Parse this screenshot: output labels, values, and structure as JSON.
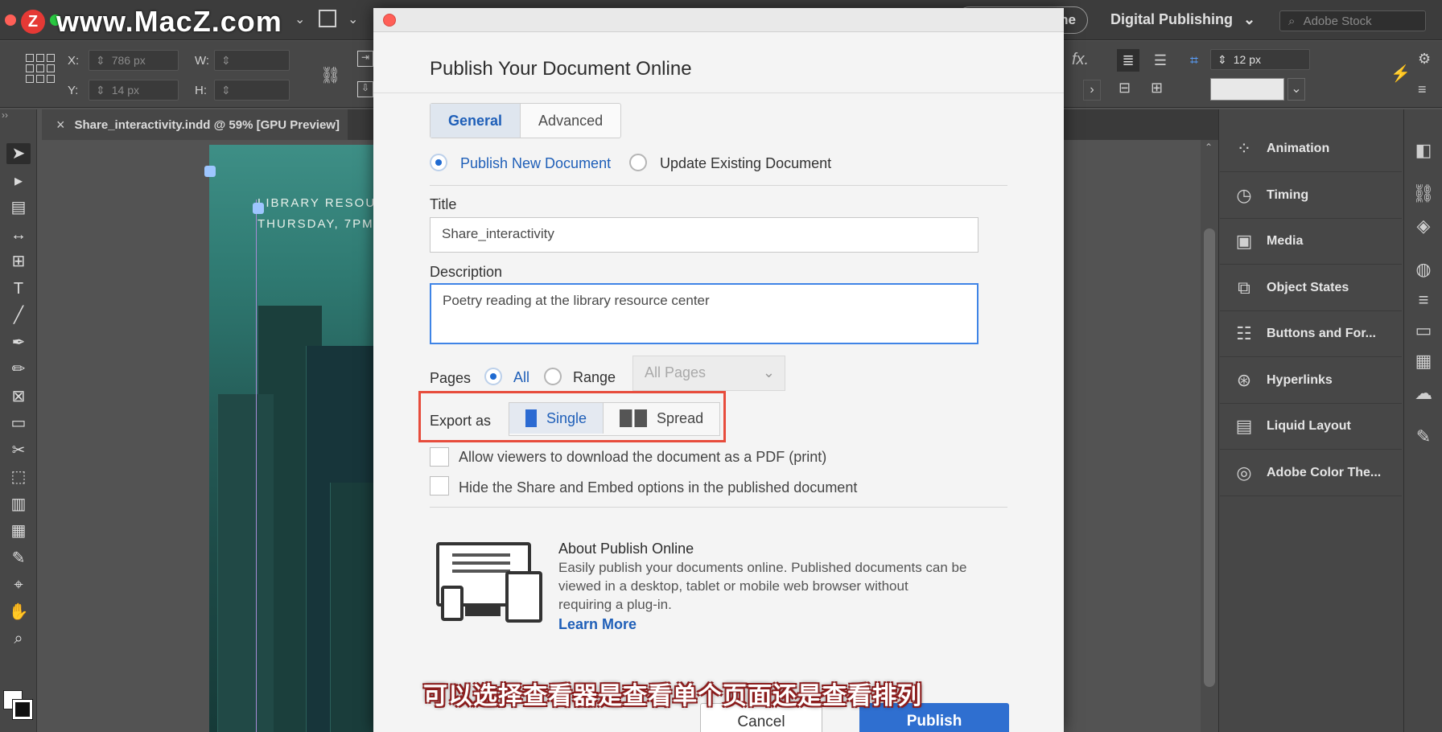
{
  "watermark": {
    "badge": "Z",
    "text": "www.MacZ.com"
  },
  "appbar": {
    "workspace": "Digital Publishing",
    "stock_placeholder": "Adobe Stock",
    "publish_button_fragment": "ne"
  },
  "ctrlbar": {
    "x_label": "X:",
    "x_value": "786 px",
    "y_label": "Y:",
    "y_value": "14 px",
    "w_label": "W:",
    "h_label": "H:",
    "fx": "fx.",
    "stroke_value": "12 px"
  },
  "document_tab": {
    "close": "×",
    "title": "Share_interactivity.indd @ 59% [GPU Preview]"
  },
  "document_page": {
    "line1": "LIBRARY RESOU",
    "line2": "THURSDAY, 7PM"
  },
  "tools": [
    "selection-tool",
    "direct-selection-tool",
    "page-tool",
    "gap-tool",
    "content-collector-tool",
    "type-tool",
    "line-tool",
    "pen-tool",
    "pencil-tool",
    "rectangle-frame-tool",
    "rectangle-tool",
    "scissors-tool",
    "free-transform-tool",
    "gradient-swatch-tool",
    "gradient-feather-tool",
    "note-tool",
    "eyedropper-tool",
    "hand-tool",
    "zoom-tool"
  ],
  "right_panel": {
    "items": [
      {
        "icon": "animation-icon",
        "label": "Animation"
      },
      {
        "icon": "timing-icon",
        "label": "Timing"
      },
      {
        "icon": "media-icon",
        "label": "Media"
      },
      {
        "icon": "object-states-icon",
        "label": "Object States"
      },
      {
        "icon": "buttons-forms-icon",
        "label": "Buttons and For..."
      },
      {
        "icon": "hyperlinks-icon",
        "label": "Hyperlinks"
      },
      {
        "icon": "liquid-layout-icon",
        "label": "Liquid Layout"
      },
      {
        "icon": "adobe-color-themes-icon",
        "label": "Adobe Color The..."
      }
    ]
  },
  "dialog": {
    "title": "Publish Your Document Online",
    "tabs": [
      {
        "label": "General",
        "active": true
      },
      {
        "label": "Advanced",
        "active": false
      }
    ],
    "mode": {
      "new_label": "Publish New Document",
      "update_label": "Update Existing Document",
      "selected": "new"
    },
    "title_field": {
      "label": "Title",
      "value": "Share_interactivity"
    },
    "description_field": {
      "label": "Description",
      "value": "Poetry reading at the library resource center"
    },
    "pages": {
      "label": "Pages",
      "all_label": "All",
      "range_label": "Range",
      "selected": "all",
      "dropdown_value": "All Pages"
    },
    "export_as": {
      "label": "Export as",
      "single_label": "Single",
      "spread_label": "Spread",
      "selected": "single"
    },
    "options": {
      "download_pdf": "Allow viewers to download the document as a PDF (print)",
      "hide_share": "Hide the Share and Embed options in the published document"
    },
    "about": {
      "heading": "About Publish Online",
      "line1": "Easily publish your documents online. Published documents can be",
      "line2": "viewed in a desktop, tablet or mobile web browser without",
      "line3": "requiring a plug-in.",
      "link": "Learn More"
    },
    "buttons": {
      "cancel": "Cancel",
      "publish": "Publish"
    }
  },
  "caption": "可以选择查看器是查看单个页面还是查看排列",
  "colors": {
    "accent": "#1f5fb8",
    "highlight": "#e74c3c",
    "publish_button": "#2f6fd0"
  }
}
